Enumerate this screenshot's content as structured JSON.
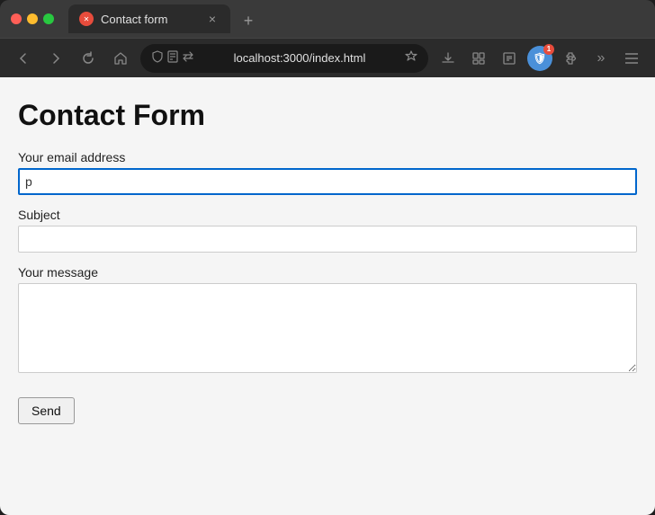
{
  "browser": {
    "tab_title": "Contact form",
    "tab_close": "×",
    "new_tab": "+",
    "address": "localhost:3000/index.html",
    "nav": {
      "back": "‹",
      "forward": "›",
      "reload": "↻",
      "home": "⌂"
    },
    "ext_badge": "1"
  },
  "page": {
    "heading": "Contact Form",
    "fields": [
      {
        "label": "Your email address",
        "name": "email",
        "type": "input",
        "value": "p",
        "placeholder": "",
        "focused": true
      },
      {
        "label": "Subject",
        "name": "subject",
        "type": "input",
        "value": "",
        "placeholder": "",
        "focused": false
      },
      {
        "label": "Your message",
        "name": "message",
        "type": "textarea",
        "value": "",
        "placeholder": "",
        "focused": false
      }
    ],
    "submit_label": "Send"
  }
}
